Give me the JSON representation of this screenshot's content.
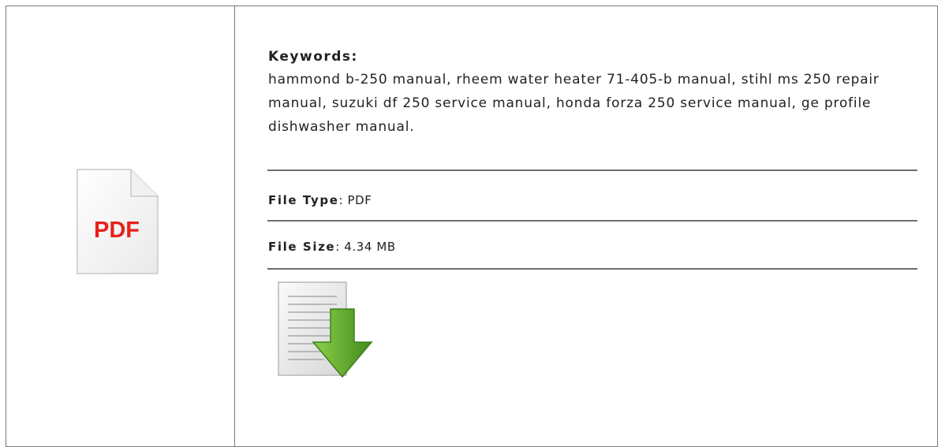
{
  "pdf_icon": {
    "label": "PDF",
    "label_color": "#e8211a"
  },
  "keywords": {
    "label": "Keywords",
    "separator": ":",
    "text": "hammond b-250 manual, rheem water heater 71-405-b manual, stihl ms 250 repair manual, suzuki df 250 service manual, honda forza 250 service manual, ge profile dishwasher manual."
  },
  "file_type": {
    "label": "File Type",
    "separator": ":",
    "value": "PDF"
  },
  "file_size": {
    "label": "File Size",
    "separator": ":",
    "value": "4.34 MB"
  },
  "download": {
    "icon": "download-document-icon",
    "arrow_color": "#5aa12a"
  }
}
